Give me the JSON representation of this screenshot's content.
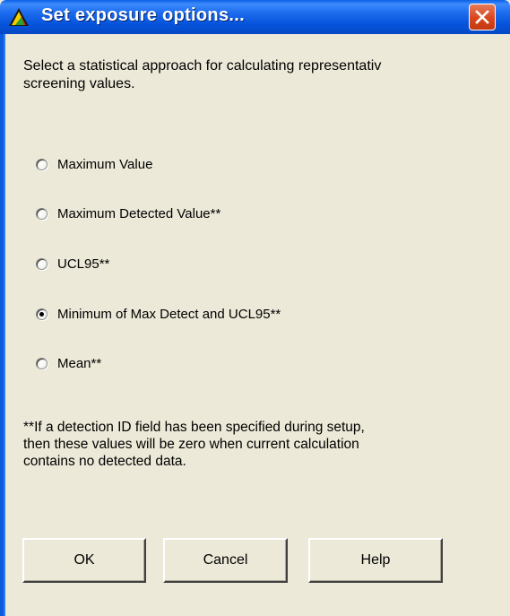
{
  "window": {
    "title": "Set exposure options...",
    "intro_text": "Select a statistical approach for calculating representativ\nscreening values."
  },
  "options": [
    {
      "label": "Maximum Value",
      "selected": false
    },
    {
      "label": "Maximum Detected Value**",
      "selected": false
    },
    {
      "label": "UCL95**",
      "selected": false
    },
    {
      "label": "Minimum of Max Detect and UCL95**",
      "selected": true
    },
    {
      "label": "Mean**",
      "selected": false
    }
  ],
  "footnote": "**If a detection ID field has been specified during setup,\nthen these values will be zero when current calculation\ncontains no detected data.",
  "buttons": {
    "ok": "OK",
    "cancel": "Cancel",
    "help": "Help"
  },
  "colors": {
    "titlebar": "#0654dc",
    "close_button": "#d8461c",
    "dialog_bg": "#ece9d8"
  }
}
